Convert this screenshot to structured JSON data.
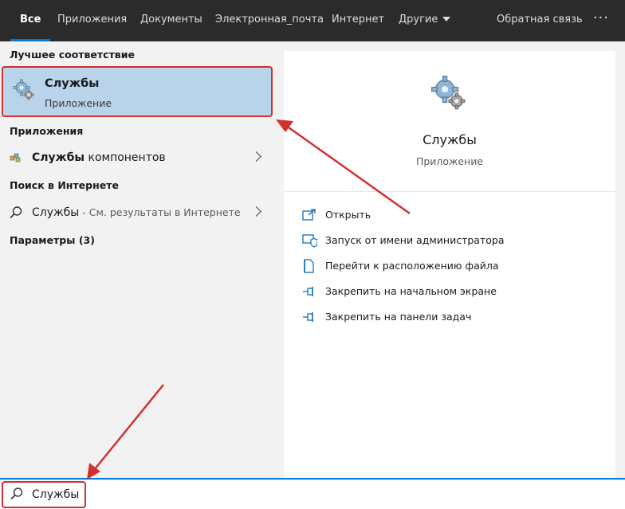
{
  "tabs": [
    {
      "label": "Все",
      "active": true
    },
    {
      "label": "Приложения"
    },
    {
      "label": "Документы"
    },
    {
      "label": "Электронная_почта"
    },
    {
      "label": "Интернет"
    },
    {
      "label": "Другие"
    }
  ],
  "feedback_label": "Обратная связь",
  "more_label": "···",
  "left": {
    "best_match_title": "Лучшее соответствие",
    "best_match": {
      "name": "Службы",
      "type": "Приложение",
      "icon": "gear-icon"
    },
    "apps_title": "Приложения",
    "apps_item": {
      "bold": "Службы",
      "rest": " компонентов",
      "icon": "component-services-icon"
    },
    "web_title": "Поиск в Интернете",
    "web_item": {
      "bold": "Службы",
      "hint": " - См. результаты в Интернете",
      "icon": "search-icon"
    },
    "settings_title": "Параметры (3)"
  },
  "preview": {
    "name": "Службы",
    "type": "Приложение",
    "icon": "gear-icon",
    "actions": [
      {
        "label": "Открыть",
        "icon": "open-icon"
      },
      {
        "label": "Запуск от имени администратора",
        "icon": "shield-icon"
      },
      {
        "label": "Перейти к расположению файла",
        "icon": "file-location-icon"
      },
      {
        "label": "Закрепить на начальном экране",
        "icon": "pin-icon"
      },
      {
        "label": "Закрепить на панели задач",
        "icon": "pin-icon"
      }
    ]
  },
  "search": {
    "value": "Службы",
    "icon": "search-icon"
  },
  "colors": {
    "accent": "#0078d4",
    "highlight": "#d32f2f",
    "selection": "#b8d3ea",
    "topbar": "#2b2b2b"
  }
}
